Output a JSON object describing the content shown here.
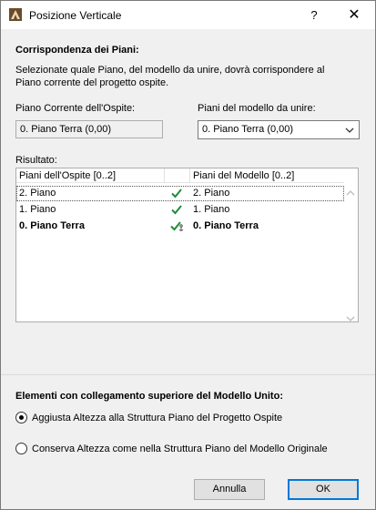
{
  "window": {
    "title": "Posizione Verticale",
    "help": "?",
    "close": "✕"
  },
  "section1": {
    "heading": "Corrispondenza dei Piani:",
    "desc_line1": "Selezionate quale Piano, del modello da unire, dovrà corrispondere al",
    "desc_line2": "Piano corrente del progetto ospite."
  },
  "host_floor": {
    "label": "Piano Corrente dell'Ospite:",
    "value": "0. Piano Terra (0,00)"
  },
  "model_floor": {
    "label": "Piani del modello da unire:",
    "selected": "0. Piano Terra (0,00)"
  },
  "result": {
    "label": "Risultato:",
    "col_host": "Piani dell'Ospite [0..2]",
    "col_model": "Piani del Modello [0..2]",
    "rows": [
      {
        "host": "2. Piano",
        "model": "2. Piano",
        "bold": false,
        "selected": true
      },
      {
        "host": "1. Piano",
        "model": "1. Piano",
        "bold": false,
        "selected": false
      },
      {
        "host": "0. Piano Terra",
        "model": "0. Piano Terra",
        "bold": true,
        "selected": false
      }
    ]
  },
  "section2": {
    "heading": "Elementi con collegamento superiore del Modello Unito:",
    "options": [
      {
        "label": "Aggiusta Altezza alla Struttura Piano del Progetto Ospite",
        "checked": true
      },
      {
        "label": "Conserva Altezza come nella Struttura Piano del Modello Originale",
        "checked": false
      }
    ]
  },
  "buttons": {
    "cancel": "Annulla",
    "ok": "OK"
  },
  "colors": {
    "check": "#1e8c3a",
    "accent": "#0078d7"
  },
  "icons": {
    "app": "archicad-icon",
    "dropdown": "chevron-down-icon",
    "check": "checkmark-icon"
  }
}
